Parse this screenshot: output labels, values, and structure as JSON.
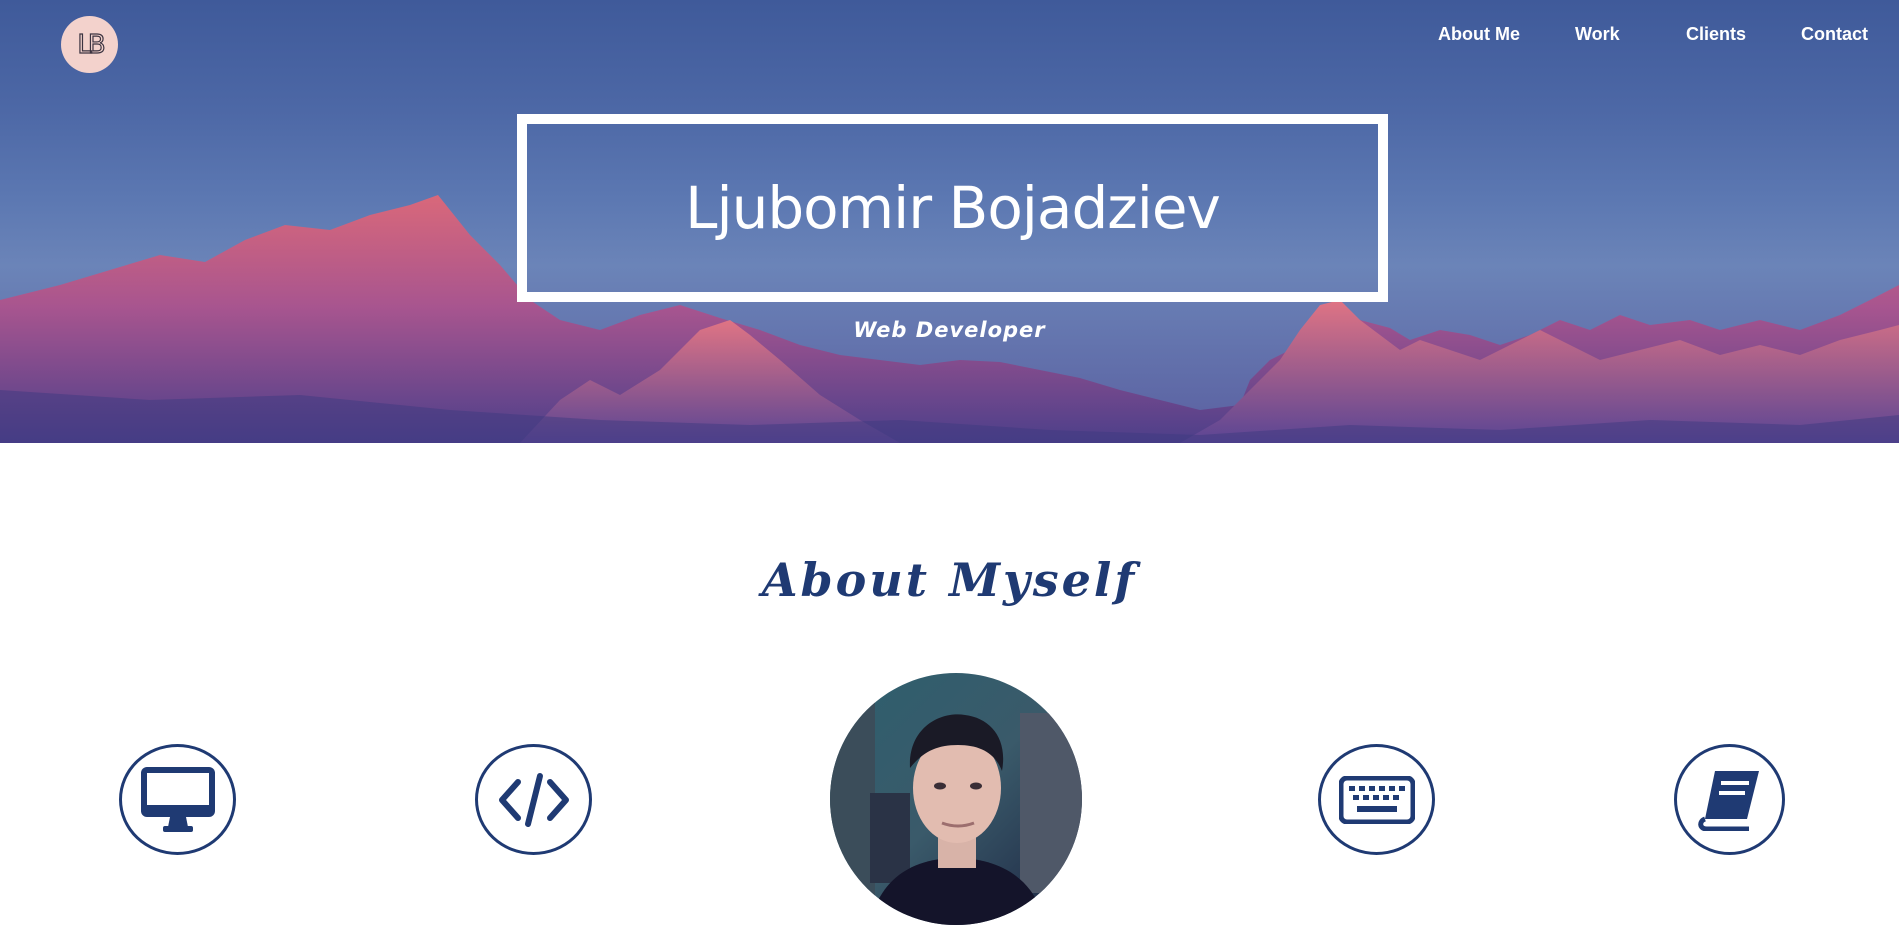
{
  "header": {
    "logo_text": "LB",
    "nav": [
      {
        "label": "About Me"
      },
      {
        "label": "Work"
      },
      {
        "label": "Clients"
      },
      {
        "label": "Contact"
      }
    ]
  },
  "hero": {
    "name": "Ljubomir Bojadziev",
    "role": "Web Developer"
  },
  "about": {
    "title": "About Myself",
    "icons": [
      "desktop-icon",
      "code-icon",
      "keyboard-icon",
      "book-icon"
    ]
  },
  "colors": {
    "accent": "#1f3a73",
    "logo_bg": "#f3d2cc",
    "hero_sky": "#4d68a6",
    "mountain": "#d9687a"
  }
}
